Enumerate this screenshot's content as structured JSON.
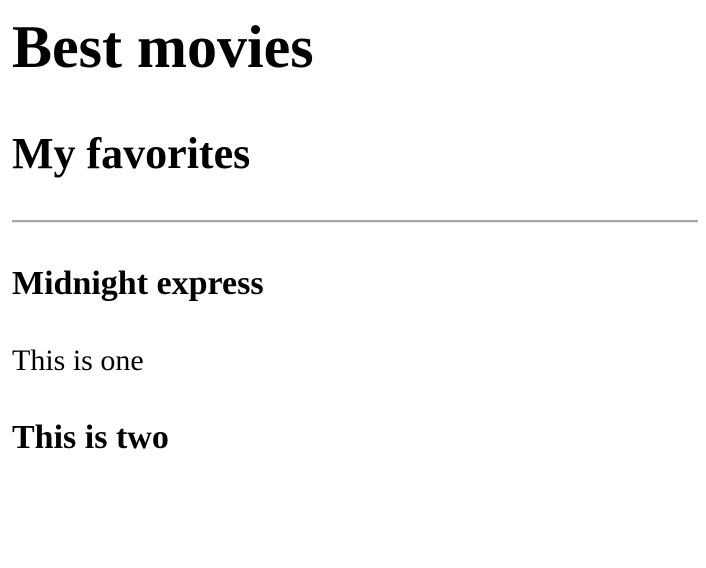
{
  "document": {
    "title": "Best movies",
    "subtitle": "My favorites",
    "sections": [
      {
        "heading": "Midnight express",
        "text": "This is one"
      },
      {
        "heading": "This is two"
      }
    ]
  }
}
